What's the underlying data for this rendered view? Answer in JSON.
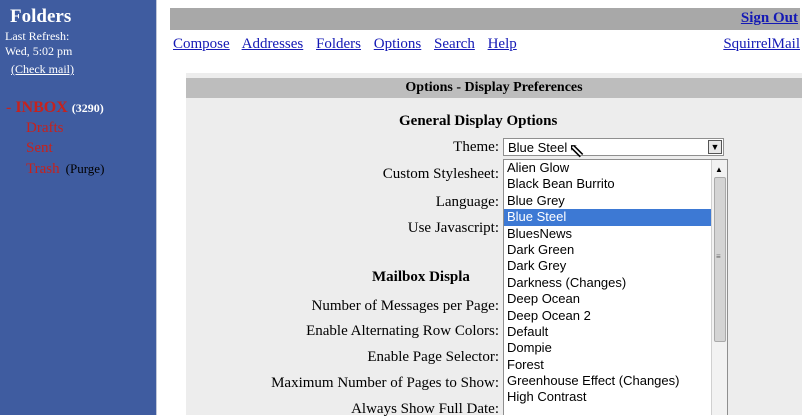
{
  "sidebar": {
    "title": "Folders",
    "last_refresh_label": "Last Refresh:",
    "last_refresh_time": "Wed, 5:02 pm",
    "check_mail": "(Check mail)",
    "inbox_dash": "-",
    "inbox_name": "INBOX",
    "inbox_count": "(3290)",
    "drafts": "Drafts",
    "sent": "Sent",
    "trash": "Trash",
    "purge": "(Purge)"
  },
  "nav": {
    "sign_out": "Sign Out",
    "links": [
      "Compose",
      "Addresses",
      "Folders",
      "Options",
      "Search",
      "Help"
    ],
    "squirrelmail": "SquirrelMail"
  },
  "options": {
    "header": "Options - Display Preferences",
    "general_title": "General Display Options",
    "theme_label": "Theme:",
    "theme_value": "Blue Steel",
    "stylesheet_label": "Custom Stylesheet:",
    "language_label": "Language:",
    "javascript_label": "Use Javascript:",
    "mailbox_title": "Mailbox Displa",
    "messages_per_page": "Number of Messages per Page:",
    "alternating_rows": "Enable Alternating Row Colors:",
    "page_selector": "Enable Page Selector:",
    "max_pages": "Maximum Number of Pages to Show:",
    "always_show": "Always Show Full Date:"
  },
  "theme_options": [
    "Alien Glow",
    "Black Bean Burrito",
    "Blue Grey",
    "Blue Steel",
    "BluesNews",
    "Dark Green",
    "Dark Grey",
    "Darkness (Changes)",
    "Deep Ocean",
    "Deep Ocean 2",
    "Default",
    "Dompie",
    "Forest",
    "Greenhouse Effect (Changes)",
    "High Contrast"
  ],
  "selected_theme_index": 3,
  "colors": {
    "sidebar_bg": "#3f5ca0",
    "folder_red": "#c6221d",
    "link_blue": "#1419b5",
    "selection_blue": "#3d79d4"
  }
}
